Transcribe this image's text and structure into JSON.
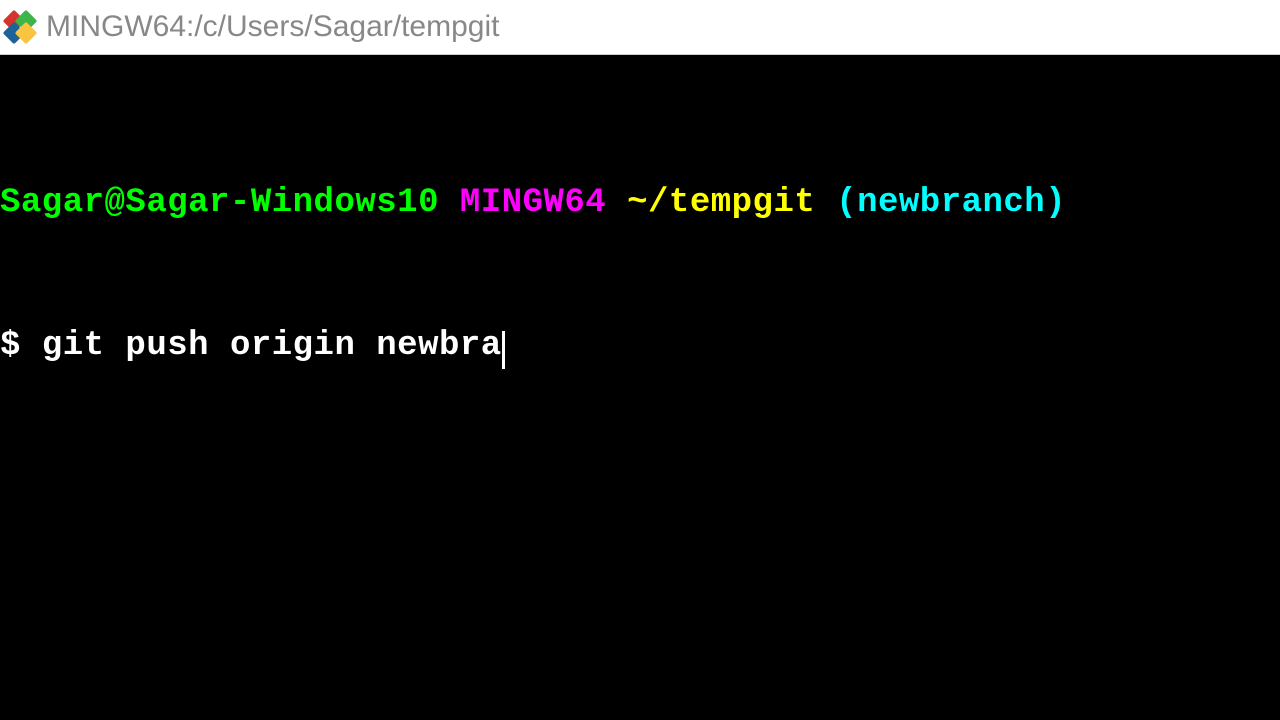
{
  "titlebar": {
    "title": "MINGW64:/c/Users/Sagar/tempgit"
  },
  "terminal": {
    "prompt": {
      "userHost": "Sagar@Sagar-Windows10",
      "env": "MINGW64",
      "path": "~/tempgit",
      "branch": "(newbranch)"
    },
    "command": {
      "dollar": "$",
      "text": "git push origin newbra"
    }
  },
  "colors": {
    "userHost": "#00ff00",
    "env": "#ff00ff",
    "path": "#ffff00",
    "branch": "#00ffff",
    "text": "#ffffff"
  }
}
